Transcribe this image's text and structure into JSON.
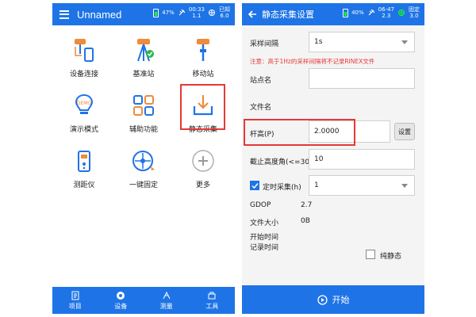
{
  "left": {
    "title": "Unnamed",
    "status": {
      "battery": "47%",
      "time": "00:33",
      "sat_count": "1.1",
      "fix": "已知",
      "fix_val": "6.0"
    },
    "grid": [
      {
        "label": "设备连接",
        "icon": "device-connect-icon"
      },
      {
        "label": "基准站",
        "icon": "base-station-icon"
      },
      {
        "label": "移动站",
        "icon": "rover-icon"
      },
      {
        "label": "演示模式",
        "icon": "demo-bulb-icon"
      },
      {
        "label": "辅助功能",
        "icon": "auxiliary-grid-icon"
      },
      {
        "label": "静态采集",
        "icon": "static-download-icon"
      },
      {
        "label": "测距仪",
        "icon": "rangefinder-icon"
      },
      {
        "label": "一键固定",
        "icon": "one-key-fix-icon"
      },
      {
        "label": "更多",
        "icon": "more-plus-icon"
      }
    ],
    "nav": [
      {
        "label": "项目",
        "icon": "project-icon"
      },
      {
        "label": "设备",
        "icon": "device-icon"
      },
      {
        "label": "测量",
        "icon": "survey-icon"
      },
      {
        "label": "工具",
        "icon": "tools-icon"
      }
    ]
  },
  "right": {
    "title": "静态采集设置",
    "status": {
      "battery": "40%",
      "time": "06-47",
      "sat_count": "2.3",
      "fix": "固定",
      "fix_val": "3.0"
    },
    "sample_interval_label": "采样间隔",
    "sample_interval_value": "1s",
    "warning": "注意：高于1Hz的采样间隔将不记录RINEX文件",
    "site_name_label": "站点名",
    "site_name_value": "",
    "file_name_label": "文件名",
    "pole_height_label": "杆高(P)",
    "pole_height_value": "2.0000",
    "settings_button": "设置",
    "cutoff_label": "截止高度角(<=30°)",
    "cutoff_value": "10",
    "timed_label": "定时采集(h)",
    "timed_value": "1",
    "timed_checked": true,
    "gdop_label": "GDOP",
    "gdop_value": "2.7",
    "file_size_label": "文件大小",
    "file_size_value": "0B",
    "start_time_label": "开始时间",
    "record_time_label": "记录时间",
    "pure_static_label": "纯静态",
    "start_button": "开始"
  },
  "colors": {
    "primary": "#1e74e6",
    "highlight": "#e53935"
  }
}
